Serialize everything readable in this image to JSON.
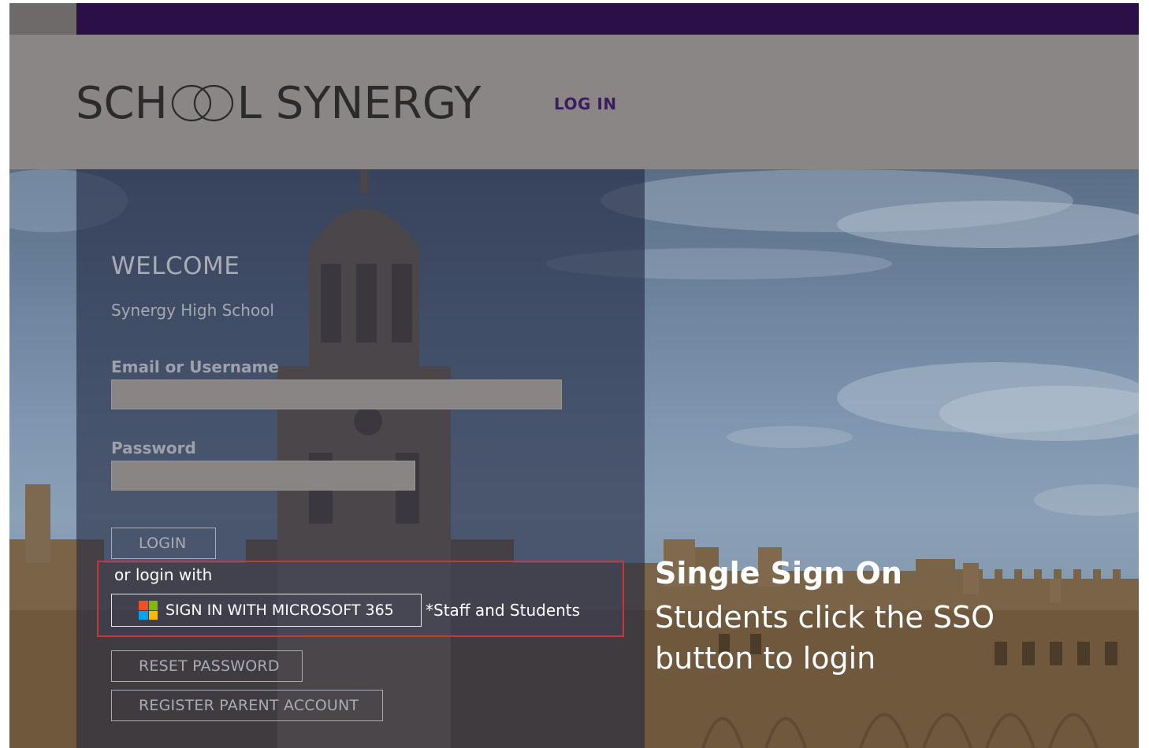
{
  "header": {
    "logo_text": "SCHOOL SYNERGY",
    "nav_login": "LOG IN"
  },
  "login_panel": {
    "welcome": "WELCOME",
    "school_name": "Synergy High School",
    "email_label": "Email or Username",
    "email_value": "",
    "password_label": "Password",
    "password_value": "",
    "login_button": "LOGIN",
    "or_login_with": "or login with",
    "microsoft_button": "SIGN IN WITH MICROSOFT 365",
    "staff_note": "*Staff and Students",
    "reset_password_button": "RESET PASSWORD",
    "register_parent_button": "REGISTER PARENT ACCOUNT"
  },
  "sso_callout": {
    "title": "Single Sign On",
    "description": "Students click the SSO button to login"
  },
  "colors": {
    "top_bar": "#2a1047",
    "nav_login": "#3b1d5e",
    "highlight_border": "#c8353b"
  },
  "icons": [
    "microsoft-logo-icon"
  ]
}
